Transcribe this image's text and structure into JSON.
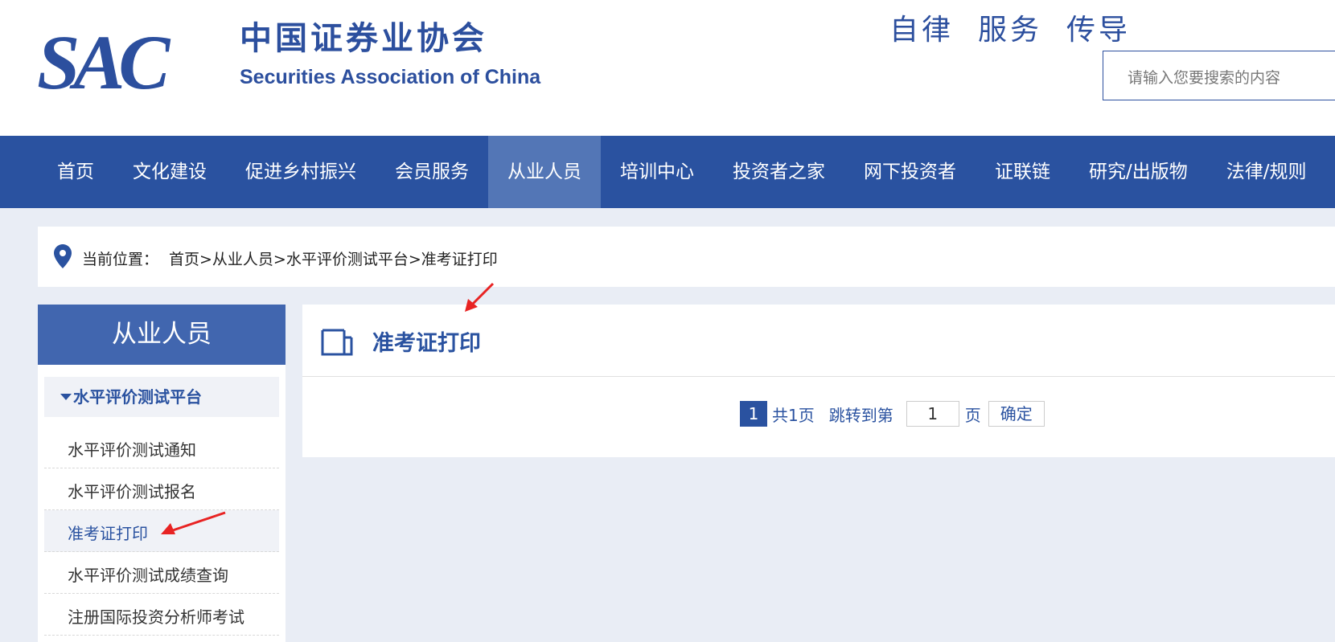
{
  "header": {
    "logo_mark": "SAC",
    "logo_cn": "中国证券业协会",
    "logo_en": "Securities Association of China",
    "slogan": [
      "自律",
      "服务",
      "传导"
    ],
    "search_placeholder": "请输入您要搜索的内容"
  },
  "nav": {
    "items": [
      "首页",
      "文化建设",
      "促进乡村振兴",
      "会员服务",
      "从业人员",
      "培训中心",
      "投资者之家",
      "网下投资者",
      "证联链",
      "研究/出版物",
      "法律/规则"
    ],
    "active": "从业人员"
  },
  "breadcrumb": {
    "label": "当前位置：",
    "path": "首页>从业人员>水平评价测试平台>准考证打印"
  },
  "sidebar": {
    "title": "从业人员",
    "category": "水平评价测试平台",
    "items": [
      "水平评价测试通知",
      "水平评价测试报名",
      "准考证打印",
      "水平评价测试成绩查询",
      "注册国际投资分析师考试"
    ],
    "active": "准考证打印"
  },
  "content": {
    "title": "准考证打印"
  },
  "pager": {
    "current": "1",
    "total": "共1页",
    "jump_label": "跳转到第",
    "input_value": "1",
    "unit": "页",
    "confirm": "确定"
  },
  "colors": {
    "brand_blue": "#2a52a0",
    "nav_active": "#5376b6",
    "sidebar_title": "#4166af",
    "page_bg": "#e9edf5",
    "annotation_arrow": "#e82323"
  }
}
